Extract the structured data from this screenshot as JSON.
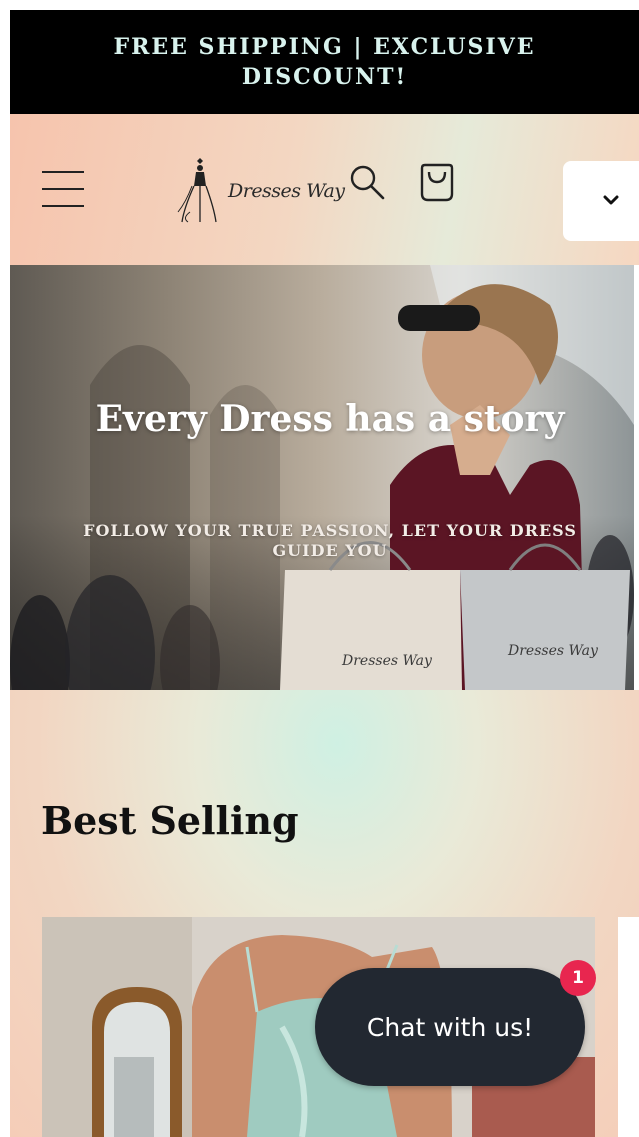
{
  "announcement": {
    "text": "FREE SHIPPING | EXCLUSIVE DISCOUNT!"
  },
  "header": {
    "logo_text": "Dresses Way",
    "menu_icon": "hamburger-icon",
    "search_icon": "search-icon",
    "cart_icon": "cart-icon",
    "dropdown_icon": "chevron-down-icon"
  },
  "hero": {
    "title": "Every Dress has a story",
    "subtitle": "FOLLOW YOUR TRUE PASSION, LET YOUR DRESS GUIDE YOU",
    "bag_logo_text": "Dresses Way"
  },
  "best_selling": {
    "title": "Best Selling"
  },
  "chat": {
    "label": "Chat with us!",
    "badge_count": "1"
  },
  "colors": {
    "announcement_bg": "#000000",
    "announcement_text": "#d9f3ee",
    "header_bg": "#f3d7c2",
    "chat_bg": "#222831",
    "badge": "#e8264f"
  }
}
